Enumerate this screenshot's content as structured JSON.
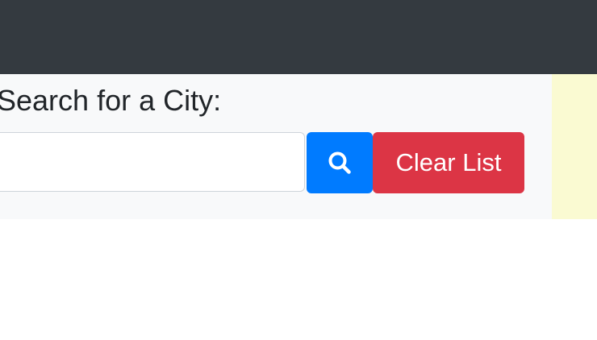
{
  "search": {
    "heading": "Search for a City:",
    "input_value": "",
    "search_icon": "magnifying-glass-icon",
    "clear_label": "Clear List"
  },
  "colors": {
    "navbar": "#343a40",
    "panel": "#f8f9fa",
    "side_panel": "#fafad2",
    "search_button": "#007bff",
    "clear_button": "#dc3545"
  }
}
